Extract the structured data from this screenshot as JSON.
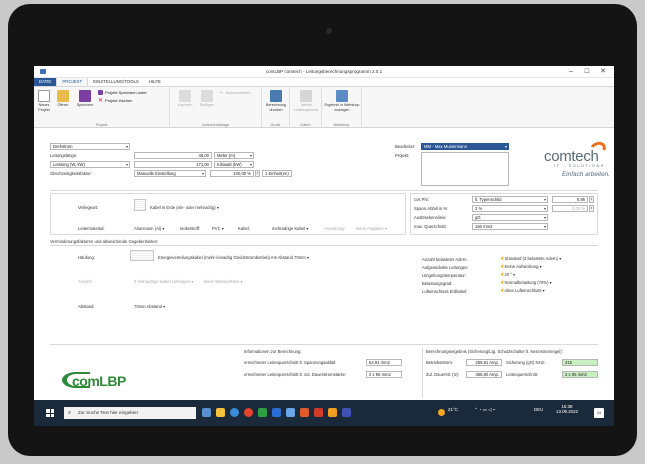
{
  "window": {
    "title": "comLBP comtech - Leitungsberechnungsprogramm 2.0.1"
  },
  "ribbon_tabs": [
    "DATEI",
    "PROJEKT",
    "EINSTELLUNG/TOOLS",
    "HILFE"
  ],
  "ribbon": {
    "new": "Neues Projekt",
    "open": "Öffnen",
    "save": "Speichern",
    "save_as": "Projekt Speichern unter",
    "delete": "Projekt löschen",
    "group_project": "Projekt",
    "copy": "Kopieren",
    "paste": "Einfügen",
    "cut": "Ausschneiden",
    "group_clipboard": "Zwischenablage",
    "print": "Berechnung drucken",
    "group_print": "Druck",
    "tabelle": "Tabelle Leistungswerte",
    "group_daten": "Daten",
    "webshop": "Ergebnis in Webshop anzeigen",
    "group_webshop": "Webshop"
  },
  "inputs": {
    "netz": "Drehstrom",
    "leitungslaenge_label": "Leitungslänge:",
    "leitungslaenge": "45,00",
    "leitungslaenge_unit": "Meter (m)",
    "leistung_label": "Leistung (W, kW)",
    "leistung": "171,00",
    "leistung_unit": "Kilowatt (kW)",
    "gleich_label": "Gleichzeitigkeitsfaktor:",
    "gleich_mode": "Manuelle Einstellung",
    "gleich_value": "100,00 %",
    "einheiten": "1 Einheit(en)"
  },
  "bearbeiter": {
    "label": "Bearbeiter:",
    "value": "MM - Max Mustermann",
    "projekt_label": "Projekt:"
  },
  "logo": {
    "name": "comtech",
    "sub": "IT - SOLUTIONS",
    "tagline": "Einfach arbeiten."
  },
  "verlegung": {
    "label": "Verlegeart:",
    "value": "Kabel in Erde (ein- oder mehradrig)",
    "leitermaterial_label": "Leitermaterial:",
    "leitermaterial": "Aluminium (Al)",
    "isolierstoff_label": "Isolierstoff:",
    "isolierstoff": "PVC",
    "kabel_label": "Kabel:",
    "kabel": "mehradrige Kabel",
    "anordnung": "Anordnung:",
    "anordnung_value": "keine Angaben"
  },
  "cos": {
    "cosphi_label": "cos Phi:",
    "cosphi_mode": "lt. Typenschild",
    "cosphi_value": "0,95",
    "spann_label": "Spann.Abfall in %:",
    "spann_value": "3 %",
    "spann_extra": "3,00 %",
    "ausloese_label": "Auslösekennlinie:",
    "ausloese": "gG",
    "max_label": "max. Querschnitt:",
    "max": "150 mm2"
  },
  "reduction": {
    "title": "Verminderungsfaktoren und abweichende Gegebenheiten:",
    "haeufung_label": "Häufung:",
    "haeufung": "Energieverteilungskabel (mehr-/einadrig Gleichstrombetrieb) mit Abstand 70mm",
    "anzahl_label": "Anzahl:",
    "anzahl": "2 mehradrige Kabel Leitungen",
    "anzahl_extra": "keine Wärme/Kreis",
    "abstand_label": "Abstand:",
    "abstand": "70mm Abstand"
  },
  "right_info": {
    "belastete_label": "Anzahl belasteter Adern:",
    "belastete": "Standard (3 belastete Adern)",
    "aufwick_label": "Aufgewickelte Leitungen:",
    "aufwick": "Keine Aufwicklung",
    "temp_label": "Umgebungstemperatur:",
    "temp": "20 °",
    "belast_label": "Belastungsgrad:",
    "belast": "Normalbelastung (70%)",
    "luft_label": "Lufteinschluss Erdkabel:",
    "luft": "ohne Lufteinschluss"
  },
  "info": {
    "title": "Informationen zur Berechnung:",
    "req1_label": "erreichneter Leiterquerschnitt lt. Spannungsabfall:",
    "req1": "54,91 mm2",
    "req2_label": "erreichneter Leiterquerschnitt lt. zul. Dauerstromstärke:",
    "req2": "2 x 95 mm2"
  },
  "result": {
    "title": "Berechnungsergebnis (Sicherung/Ltg. Schutzschalter lt. Nennstromregel):",
    "betrieb_label": "Betriebsstrom:",
    "betrieb": "259,81 Amp.",
    "sich_label": "Sicherung (gG) NH2:",
    "sich": "315",
    "dauer_label": "Zul. Dauerstr. (Iz):",
    "dauer": "368,80 Amp.",
    "leiter_label": "Leiterquerschnitt:",
    "leiter": "2 x 95 mm2"
  },
  "brand": {
    "name": "comLBP"
  },
  "taskbar": {
    "search_placeholder": "Zur Suche Text hier eingeben",
    "weather": "21°C",
    "lang": "DEU",
    "time": "15:38",
    "date": "13.09.2022",
    "notif": "24"
  },
  "colors": {
    "accent": "#2b5797",
    "green": "#2f8a3a",
    "orange": "#e8731d",
    "result_green": "#c8f0c0"
  }
}
